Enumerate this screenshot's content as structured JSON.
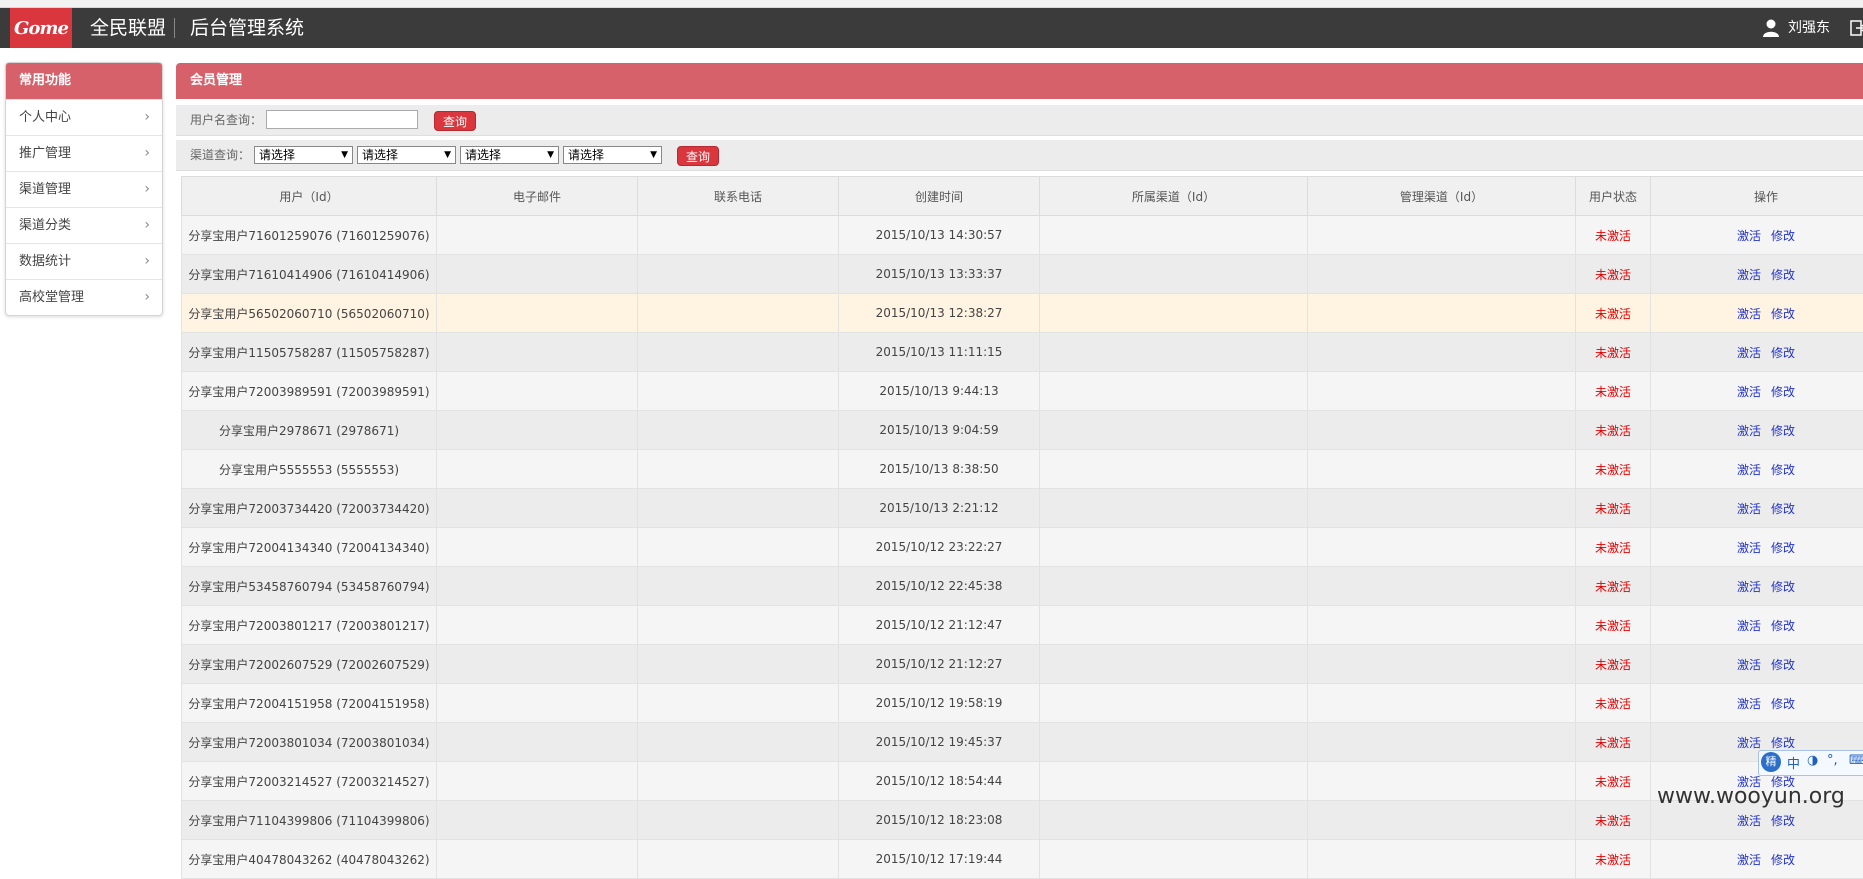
{
  "header": {
    "logo_text": "Gome",
    "brand": "全民联盟",
    "system_title": "后台管理系统",
    "username": "刘强东"
  },
  "sidebar": {
    "title": "常用功能",
    "items": [
      {
        "label": "个人中心"
      },
      {
        "label": "推广管理"
      },
      {
        "label": "渠道管理"
      },
      {
        "label": "渠道分类"
      },
      {
        "label": "数据统计"
      },
      {
        "label": "高校堂管理"
      }
    ]
  },
  "panel": {
    "title": "会员管理",
    "search": {
      "label": "用户名查询：",
      "value": "",
      "button": "查询"
    },
    "channel_search": {
      "label": "渠道查询：",
      "selects": [
        "请选择",
        "请选择",
        "请选择",
        "请选择"
      ],
      "button": "查询"
    }
  },
  "table": {
    "columns": [
      "用户（Id）",
      "电子邮件",
      "联系电话",
      "创建时间",
      "所属渠道（Id）",
      "管理渠道（Id）",
      "用户状态",
      "操作"
    ],
    "rows": [
      {
        "user": "分享宝用户71601259076 (71601259076)",
        "email": "",
        "phone": "",
        "created": "2015/10/13 14:30:57",
        "channel": "",
        "manage": "",
        "status": "未激活"
      },
      {
        "user": "分享宝用户71610414906 (71610414906)",
        "email": "",
        "phone": "",
        "created": "2015/10/13 13:33:37",
        "channel": "",
        "manage": "",
        "status": "未激活"
      },
      {
        "user": "分享宝用户56502060710 (56502060710)",
        "email": "",
        "phone": "",
        "created": "2015/10/13 12:38:27",
        "channel": "",
        "manage": "",
        "status": "未激活"
      },
      {
        "user": "分享宝用户11505758287 (11505758287)",
        "email": "",
        "phone": "",
        "created": "2015/10/13 11:11:15",
        "channel": "",
        "manage": "",
        "status": "未激活"
      },
      {
        "user": "分享宝用户72003989591 (72003989591)",
        "email": "",
        "phone": "",
        "created": "2015/10/13 9:44:13",
        "channel": "",
        "manage": "",
        "status": "未激活"
      },
      {
        "user": "分享宝用户2978671 (2978671)",
        "email": "",
        "phone": "",
        "created": "2015/10/13 9:04:59",
        "channel": "",
        "manage": "",
        "status": "未激活"
      },
      {
        "user": "分享宝用户5555553 (5555553)",
        "email": "",
        "phone": "",
        "created": "2015/10/13 8:38:50",
        "channel": "",
        "manage": "",
        "status": "未激活"
      },
      {
        "user": "分享宝用户72003734420 (72003734420)",
        "email": "",
        "phone": "",
        "created": "2015/10/13 2:21:12",
        "channel": "",
        "manage": "",
        "status": "未激活"
      },
      {
        "user": "分享宝用户72004134340 (72004134340)",
        "email": "",
        "phone": "",
        "created": "2015/10/12 23:22:27",
        "channel": "",
        "manage": "",
        "status": "未激活"
      },
      {
        "user": "分享宝用户53458760794 (53458760794)",
        "email": "",
        "phone": "",
        "created": "2015/10/12 22:45:38",
        "channel": "",
        "manage": "",
        "status": "未激活"
      },
      {
        "user": "分享宝用户72003801217 (72003801217)",
        "email": "",
        "phone": "",
        "created": "2015/10/12 21:12:47",
        "channel": "",
        "manage": "",
        "status": "未激活"
      },
      {
        "user": "分享宝用户72002607529 (72002607529)",
        "email": "",
        "phone": "",
        "created": "2015/10/12 21:12:27",
        "channel": "",
        "manage": "",
        "status": "未激活"
      },
      {
        "user": "分享宝用户72004151958 (72004151958)",
        "email": "",
        "phone": "",
        "created": "2015/10/12 19:58:19",
        "channel": "",
        "manage": "",
        "status": "未激活"
      },
      {
        "user": "分享宝用户72003801034 (72003801034)",
        "email": "",
        "phone": "",
        "created": "2015/10/12 19:45:37",
        "channel": "",
        "manage": "",
        "status": "未激活"
      },
      {
        "user": "分享宝用户72003214527 (72003214527)",
        "email": "",
        "phone": "",
        "created": "2015/10/12 18:54:44",
        "channel": "",
        "manage": "",
        "status": "未激活"
      },
      {
        "user": "分享宝用户71104399806 (71104399806)",
        "email": "",
        "phone": "",
        "created": "2015/10/12 18:23:08",
        "channel": "",
        "manage": "",
        "status": "未激活"
      },
      {
        "user": "分享宝用户40478043262 (40478043262)",
        "email": "",
        "phone": "",
        "created": "2015/10/12 17:19:44",
        "channel": "",
        "manage": "",
        "status": "未激活"
      }
    ],
    "actions": {
      "activate": "激活",
      "edit": "修改"
    },
    "highlighted_row": 2
  },
  "ime": {
    "logo": "精",
    "label": "中"
  },
  "watermark": "www.wooyun.org",
  "colors": {
    "header_bg": "#3b3b3b",
    "accent": "#d6616b",
    "brand_red": "#d9363e",
    "status_red": "#e60000",
    "link_blue": "#2233cc"
  }
}
